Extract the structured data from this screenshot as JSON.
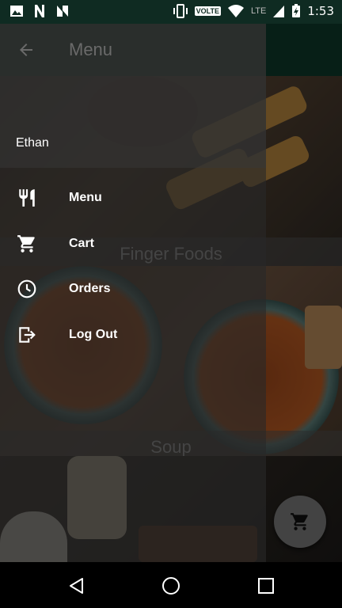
{
  "status_bar": {
    "time": "1:53",
    "network_label": "LTE",
    "volte_label": "VOLTE",
    "icons": [
      "image-icon",
      "n-app-icon",
      "n-app-icon",
      "vibrate-icon",
      "wifi-icon",
      "signal-icon",
      "battery-charging-icon"
    ]
  },
  "drawer": {
    "title": "Menu",
    "username": "Ethan",
    "items": [
      {
        "label": "Menu",
        "icon": "restaurant-icon"
      },
      {
        "label": "Cart",
        "icon": "cart-icon"
      },
      {
        "label": "Orders",
        "icon": "clock-icon"
      },
      {
        "label": "Log Out",
        "icon": "logout-icon"
      }
    ]
  },
  "categories": [
    {
      "label": "Finger Foods"
    },
    {
      "label": "Soup"
    }
  ],
  "fab": {
    "icon": "cart-icon"
  },
  "colors": {
    "status_bar": "#0f2b22",
    "app_bar": "#0e3a2a",
    "fab": "#7a7a7a",
    "drawer_text": "#ffffff"
  }
}
